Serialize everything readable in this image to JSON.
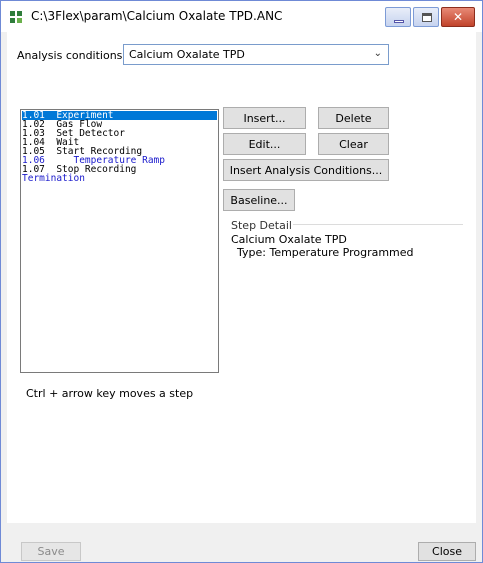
{
  "window": {
    "title": "C:\\3Flex\\param\\Calcium Oxalate TPD.ANC",
    "controls": {
      "minimize_icon": "minimize-icon",
      "maximize_icon": "maximize-icon",
      "close_icon": "close-icon"
    }
  },
  "analysis_conditions": {
    "label": "Analysis conditions:",
    "selected_value": "Calcium Oxalate TPD"
  },
  "steps": [
    {
      "number": "1.01",
      "label": "Experiment",
      "selected": true,
      "indent": false
    },
    {
      "number": "1.02",
      "label": "Gas Flow",
      "selected": false,
      "indent": false
    },
    {
      "number": "1.03",
      "label": "Set Detector",
      "selected": false,
      "indent": false
    },
    {
      "number": "1.04",
      "label": "Wait",
      "selected": false,
      "indent": false
    },
    {
      "number": "1.05",
      "label": "Start Recording",
      "selected": false,
      "indent": false
    },
    {
      "number": "1.06",
      "label": "Temperature Ramp",
      "selected": false,
      "indent": true
    },
    {
      "number": "1.07",
      "label": "Stop Recording",
      "selected": false,
      "indent": false
    }
  ],
  "steps_text": {
    "s1": "1.01  Experiment",
    "s2": "1.02  Gas Flow",
    "s3": "1.03  Set Detector",
    "s4": "1.04  Wait",
    "s5": "1.05  Start Recording",
    "s6": "1.06     Temperature Ramp",
    "s7": "1.07  Stop Recording",
    "termination": "Termination"
  },
  "buttons": {
    "insert": "Insert...",
    "delete": "Delete",
    "edit": "Edit...",
    "clear": "Clear",
    "insert_conditions": "Insert Analysis Conditions...",
    "baseline": "Baseline..."
  },
  "step_detail": {
    "heading": "Step Detail",
    "name": "Calcium Oxalate TPD",
    "type": "Type: Temperature Programmed"
  },
  "hint": "Ctrl + arrow key moves a step",
  "footer": {
    "save": "Save",
    "close": "Close"
  },
  "colors": {
    "selection": "#0078d7",
    "sub_step_text": "#1a1acc",
    "close_button": "#c1432b"
  }
}
